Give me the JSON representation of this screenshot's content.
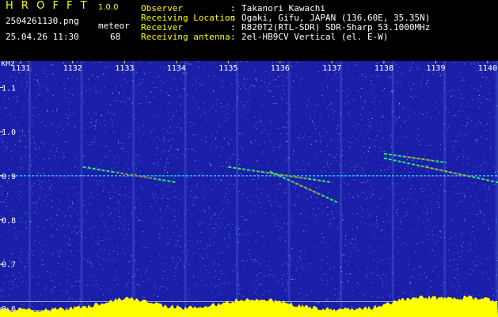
{
  "header": {
    "title": "H R O F F T",
    "version": "1.0.0",
    "file_name": "2504261130.png",
    "datetime": "25.04.26 11:30",
    "mode": "meteor",
    "count": "68",
    "info": [
      {
        "label": "Observer",
        "value": "Takanori Kawachi"
      },
      {
        "label": "Receiving Location",
        "value": "Ogaki, Gifu, JAPAN (136.60E, 35.35N)"
      },
      {
        "label": "Receiver",
        "value": "R820T2(RTL-SDR) SDR-Sharp 53.1000MHz"
      },
      {
        "label": "Receiving antenna",
        "value": "2el-HB9CV Vertical (el. E-W)"
      }
    ]
  },
  "chart_data": {
    "type": "heatmap",
    "ylabel": "kHz",
    "x_ticks": [
      "1131",
      "1132",
      "1133",
      "1134",
      "1135",
      "1136",
      "1137",
      "1138",
      "1139",
      "1140"
    ],
    "x_range": [
      1130.6,
      1140.2
    ],
    "y_ticks": [
      "1.1",
      "1.0",
      "0.9",
      "0.8",
      "0.7",
      "0.6"
    ],
    "y_range": [
      0.58,
      1.16
    ],
    "carrier_khz": 0.9,
    "reference_lines_khz": [
      0.615,
      0.595
    ],
    "echoes": [
      {
        "t_start": 1132.2,
        "t_end": 1134.0,
        "f_start": 0.92,
        "f_end": 0.885
      },
      {
        "t_start": 1135.0,
        "t_end": 1137.0,
        "f_start": 0.92,
        "f_end": 0.885
      },
      {
        "t_start": 1135.8,
        "t_end": 1137.1,
        "f_start": 0.91,
        "f_end": 0.84
      },
      {
        "t_start": 1138.0,
        "t_end": 1140.2,
        "f_start": 0.94,
        "f_end": 0.885
      },
      {
        "t_start": 1138.0,
        "t_end": 1139.2,
        "f_start": 0.95,
        "f_end": 0.93
      }
    ],
    "colors": {
      "background": "#1a1ea8",
      "noise_light": "#7fb0ff",
      "noise_cyan": "#20e0ff",
      "echo_green": "#30ff60",
      "echo_red": "#ff3030",
      "bottom_band": "#ffff00",
      "tick_text": "#ffff00",
      "axis_text": "#ffffff"
    }
  }
}
